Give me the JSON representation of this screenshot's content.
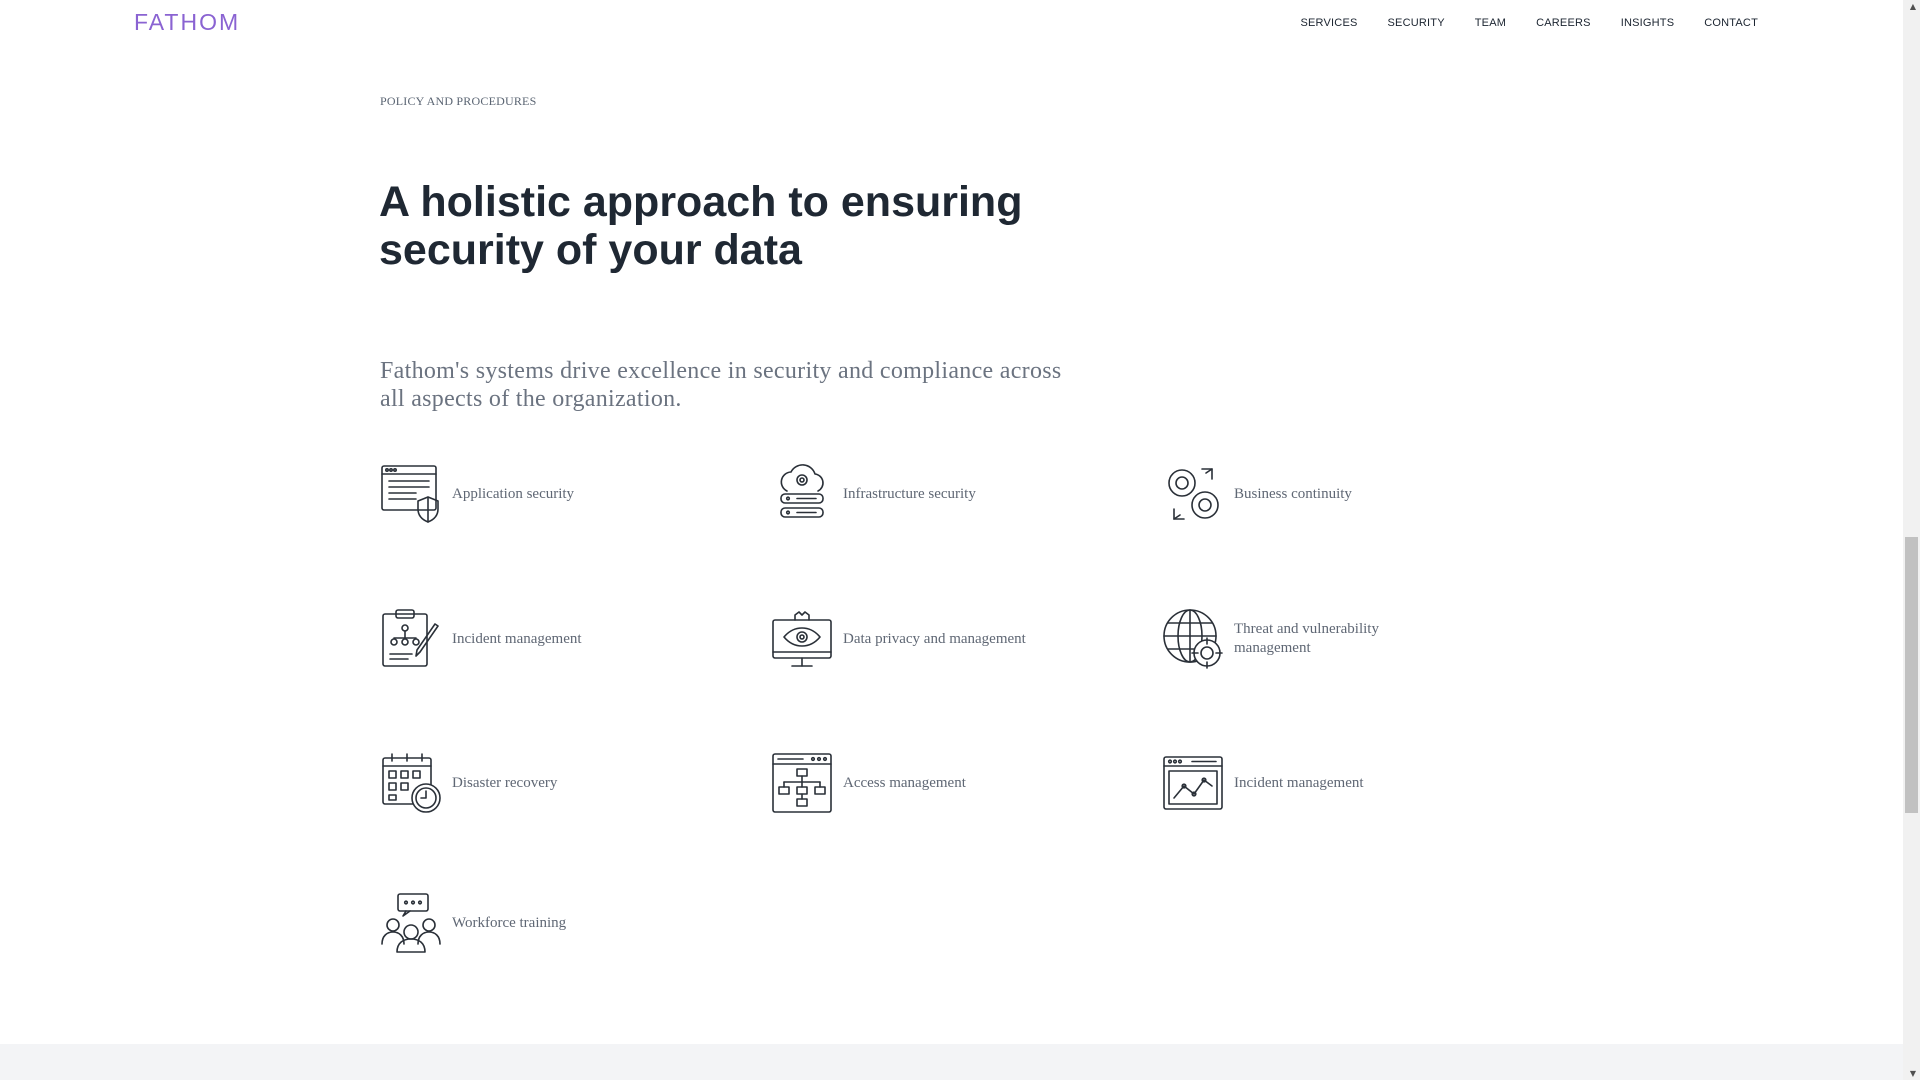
{
  "brand": {
    "logo": "FATHOM"
  },
  "nav": [
    "SERVICES",
    "SECURITY",
    "TEAM",
    "CAREERS",
    "INSIGHTS",
    "CONTACT"
  ],
  "section": {
    "eyebrow": "POLICY AND PROCEDURES",
    "headline": "A holistic approach to ensuring security of your data",
    "lede": "Fathom's systems drive excellence in security and compliance across all aspects of the organization."
  },
  "features": [
    {
      "label": "Application security",
      "icon": "app-security-icon"
    },
    {
      "label": "Infrastructure security",
      "icon": "infrastructure-icon"
    },
    {
      "label": "Business continuity",
      "icon": "gears-cycle-icon"
    },
    {
      "label": "Incident management",
      "icon": "clipboard-pen-icon"
    },
    {
      "label": "Data privacy and management",
      "icon": "monitor-eye-icon"
    },
    {
      "label": "Threat and vulnerability management",
      "icon": "globe-target-icon"
    },
    {
      "label": "Disaster recovery",
      "icon": "calendar-clock-icon"
    },
    {
      "label": "Access management",
      "icon": "browser-hierarchy-icon"
    },
    {
      "label": "Incident management",
      "icon": "browser-chart-icon"
    },
    {
      "label": "Workforce training",
      "icon": "team-chat-icon"
    }
  ],
  "colors": {
    "brand": "#8a63d2",
    "heading": "#1f2833",
    "body": "#6b7380",
    "band": "#f3f4f6"
  }
}
